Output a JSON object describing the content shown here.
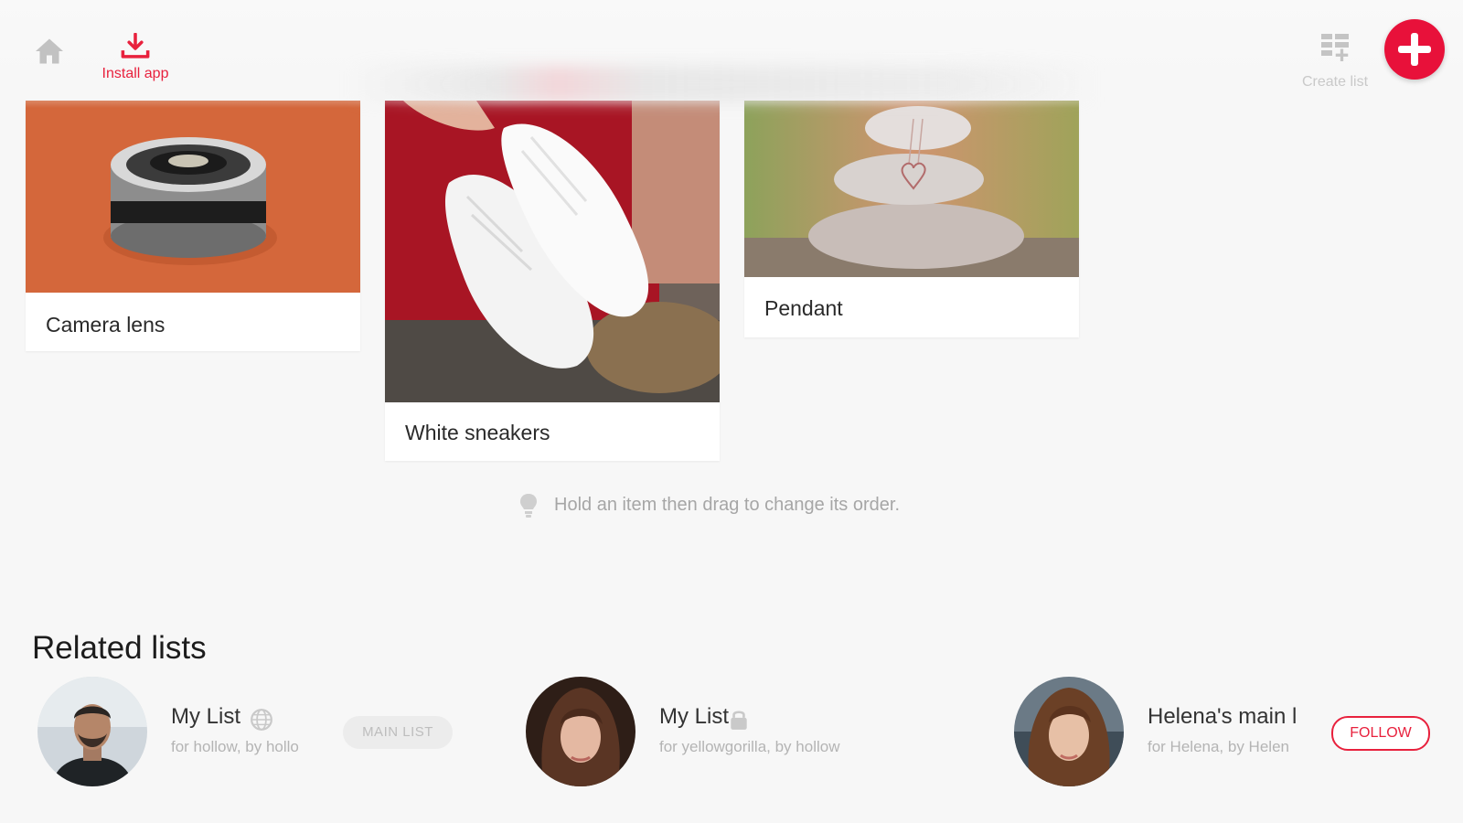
{
  "topbar": {
    "install_label": "Install app",
    "create_list_label": "Create list",
    "accent_color": "#e8213d"
  },
  "cards": [
    {
      "caption": "Camera lens"
    },
    {
      "caption": "White sneakers"
    },
    {
      "caption": "Pendant"
    }
  ],
  "hint": {
    "text": "Hold an item then drag to change its order.",
    "icon": "lightbulb-icon"
  },
  "related": {
    "title": "Related lists",
    "items": [
      {
        "name": "My List",
        "subtitle": "for hollow, by hollo",
        "visibility_icon": "globe-icon",
        "badge": "MAIN LIST"
      },
      {
        "name": "My List",
        "subtitle": "for yellowgorilla, by hollow",
        "visibility_icon": "lock-icon"
      },
      {
        "name": "Helena's main l",
        "subtitle": "for Helena, by Helen",
        "action": "FOLLOW"
      }
    ]
  }
}
